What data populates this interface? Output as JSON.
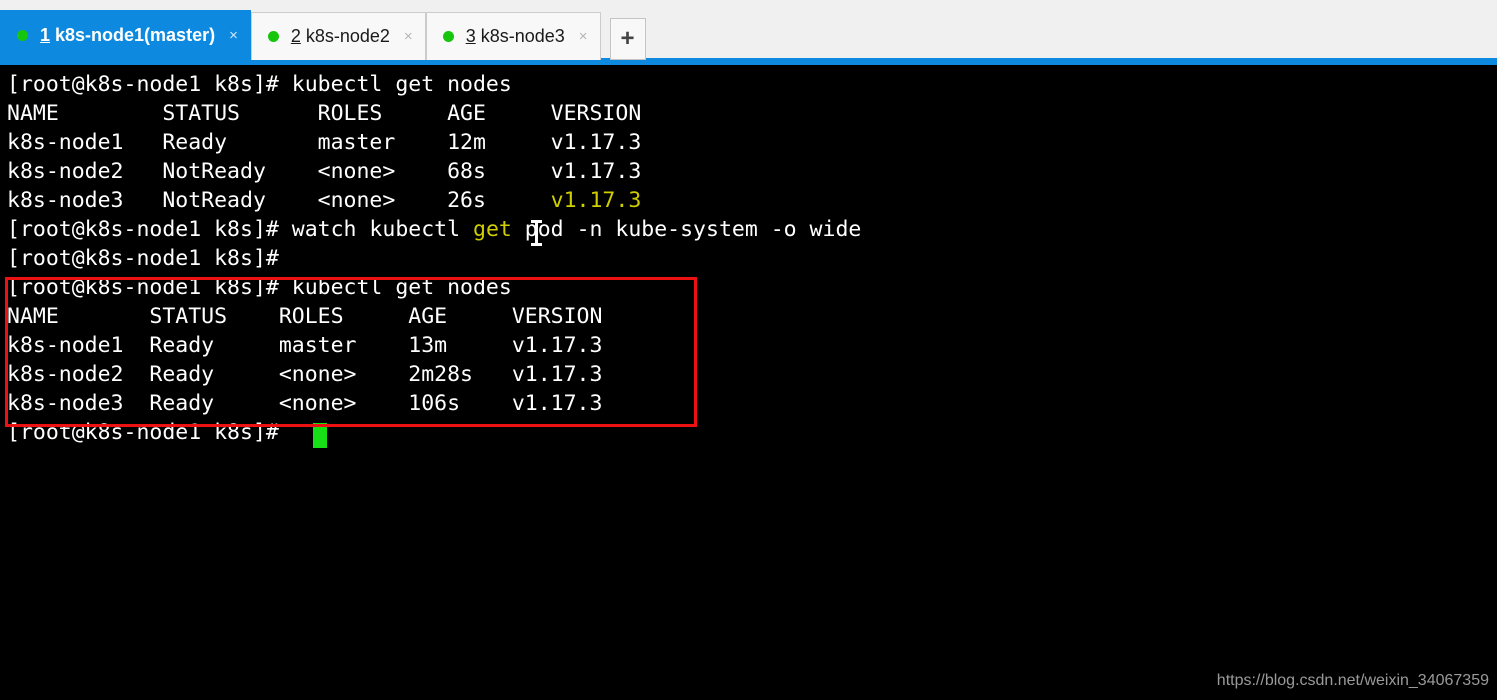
{
  "window": {
    "accent_color": "#0d8ae0",
    "tabbar_bg": "#f0f0f0",
    "terminal_bg": "#000000",
    "terminal_fg": "#d8d8d8"
  },
  "tabs": {
    "items": [
      {
        "number": "1",
        "title": "k8s-node1(master)",
        "status_dot": "green-dot-icon",
        "close_label": "×",
        "active": true
      },
      {
        "number": "2",
        "title": "k8s-node2",
        "status_dot": "green-dot-icon",
        "close_label": "×",
        "active": false
      },
      {
        "number": "3",
        "title": "k8s-node3",
        "status_dot": "green-dot-icon",
        "close_label": "×",
        "active": false
      }
    ],
    "add_tab_label": "+"
  },
  "terminal": {
    "prompt": "[root@k8s-node1 k8s]#",
    "lines": [
      {
        "id": "l01",
        "text": "[root@k8s-node1 k8s]# kubectl get nodes"
      },
      {
        "id": "l02",
        "text": "NAME        STATUS      ROLES     AGE     VERSION"
      },
      {
        "id": "l03",
        "text": "k8s-node1   Ready       master    12m     v1.17.3"
      },
      {
        "id": "l04",
        "text": "k8s-node2   NotReady    <none>    68s     v1.17.3"
      },
      {
        "id": "l05",
        "text": "k8s-node3   NotReady    <none>    26s     ",
        "highlight": "v1.17.3"
      },
      {
        "id": "l06",
        "text": "[root@k8s-node1 k8s]# watch kubectl ",
        "highlight": "get",
        "text_after": " pod -n kube-system -o wide"
      },
      {
        "id": "l07",
        "text": "[root@k8s-node1 k8s]#"
      },
      {
        "id": "l08",
        "text": "[root@k8s-node1 k8s]# kubectl get nodes"
      },
      {
        "id": "l09",
        "text": "NAME       STATUS    ROLES     AGE     VERSION"
      },
      {
        "id": "l10",
        "text": "k8s-node1  Ready     master    13m     v1.17.3"
      },
      {
        "id": "l11",
        "text": "k8s-node2  Ready     <none>    2m28s   v1.17.3"
      },
      {
        "id": "l12",
        "text": "k8s-node3  Ready     <none>    106s    v1.17.3"
      },
      {
        "id": "l13",
        "text": "[root@k8s-node1 k8s]# "
      }
    ],
    "first_table": {
      "command": "kubectl get nodes",
      "headers": [
        "NAME",
        "STATUS",
        "ROLES",
        "AGE",
        "VERSION"
      ],
      "rows": [
        [
          "k8s-node1",
          "Ready",
          "master",
          "12m",
          "v1.17.3"
        ],
        [
          "k8s-node2",
          "NotReady",
          "<none>",
          "68s",
          "v1.17.3"
        ],
        [
          "k8s-node3",
          "NotReady",
          "<none>",
          "26s",
          "v1.17.3"
        ]
      ]
    },
    "watch_command": "watch kubectl get pod -n kube-system -o wide",
    "second_table": {
      "command": "kubectl get nodes",
      "headers": [
        "NAME",
        "STATUS",
        "ROLES",
        "AGE",
        "VERSION"
      ],
      "rows": [
        [
          "k8s-node1",
          "Ready",
          "master",
          "13m",
          "v1.17.3"
        ],
        [
          "k8s-node2",
          "Ready",
          "<none>",
          "2m28s",
          "v1.17.3"
        ],
        [
          "k8s-node3",
          "Ready",
          "<none>",
          "106s",
          "v1.17.3"
        ]
      ]
    },
    "cursor": {
      "type": "block",
      "color": "#16e016"
    },
    "mouse_cursor": {
      "type": "i-beam",
      "color": "#ffffff"
    }
  },
  "annotation": {
    "red_box_color": "#ee1111",
    "description": "kubectl get nodes output highlighted"
  },
  "watermark": {
    "text": "https://blog.csdn.net/weixin_34067359"
  }
}
